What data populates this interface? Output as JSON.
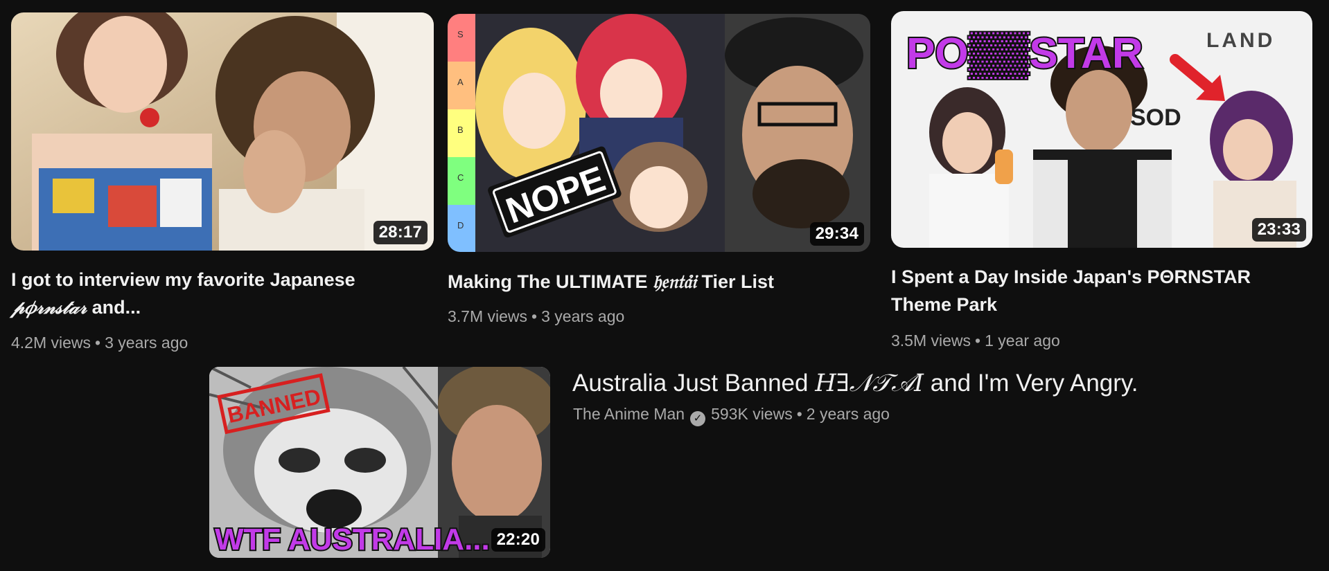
{
  "videos": [
    {
      "title_main": "I got to interview my favorite Japanese",
      "title_deco": "𝓅𝜙𝓇𝓃𝓈𝓉𝒶𝓇",
      "title_tail": " and...",
      "views": "4.2M views",
      "age": "3 years ago",
      "duration": "28:17"
    },
    {
      "title_pre": "Making The ULTIMATE ",
      "title_deco": "𝔥𝔢̣𝔫𝔱𝔞̉𝔦",
      "title_tail": " Tier List",
      "views": "3.7M views",
      "age": "3 years ago",
      "duration": "29:34",
      "overlay_text": "NOPE",
      "tier_labels": [
        "S",
        "A",
        "B",
        "C",
        "D"
      ]
    },
    {
      "title_line1": "I Spent a Day Inside Japan's PΘRNSTAR",
      "title_line2": "Theme Park",
      "views": "3.5M views",
      "age": "1 year ago",
      "duration": "23:33",
      "overlay_text": "PO▒▒STAR",
      "sign_text": "LAND"
    }
  ],
  "featured": {
    "title_pre": "Australia Just Banned ",
    "title_deco": "𝐻∃𝒩𝒯𝒜𝐼",
    "title_tail": " and I'm Very Angry.",
    "channel": "The Anime Man",
    "views": "593K views",
    "age": "2 years ago",
    "duration": "22:20",
    "stamp_text": "BANNED",
    "overlay_text": "WTF AUSTRALIA..."
  },
  "colors": {
    "background": "#0f0f0f",
    "title": "#f1f1f1",
    "meta": "#aaaaaa",
    "accent_purple": "#b63cf0"
  }
}
